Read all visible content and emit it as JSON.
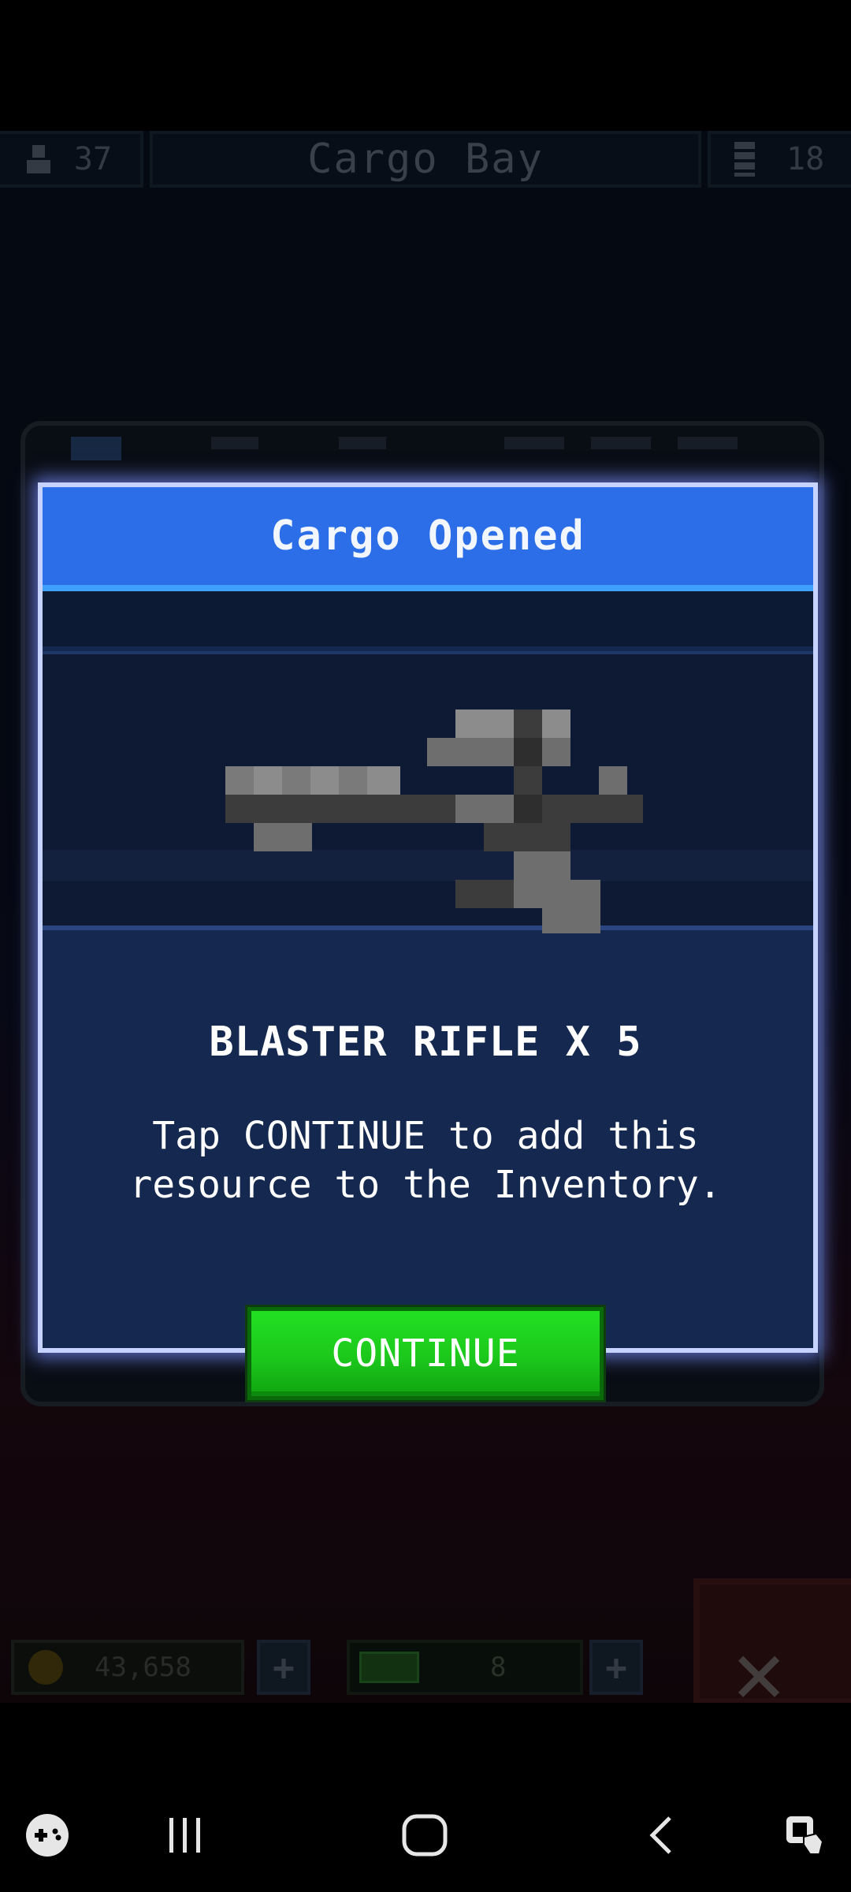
{
  "topbar": {
    "crew_count": "37",
    "title": "Cargo Bay",
    "resource_count": "18"
  },
  "modal": {
    "title": "Cargo Opened",
    "item_name": "BLASTER RIFLE X 5",
    "description": "Tap CONTINUE to add this resource to the Inventory.",
    "continue_label": "CONTINUE",
    "item_icon": "blaster-rifle-icon"
  },
  "bottombar": {
    "coins": "43,658",
    "gems": "8"
  },
  "colors": {
    "header_blue": "#2b6ee8",
    "continue_green": "#1cc81c",
    "modal_bg": "#15284f"
  },
  "navbar": {
    "icons": [
      "game-launcher-icon",
      "recent-apps-icon",
      "home-icon",
      "back-icon",
      "accessibility-icon"
    ]
  }
}
